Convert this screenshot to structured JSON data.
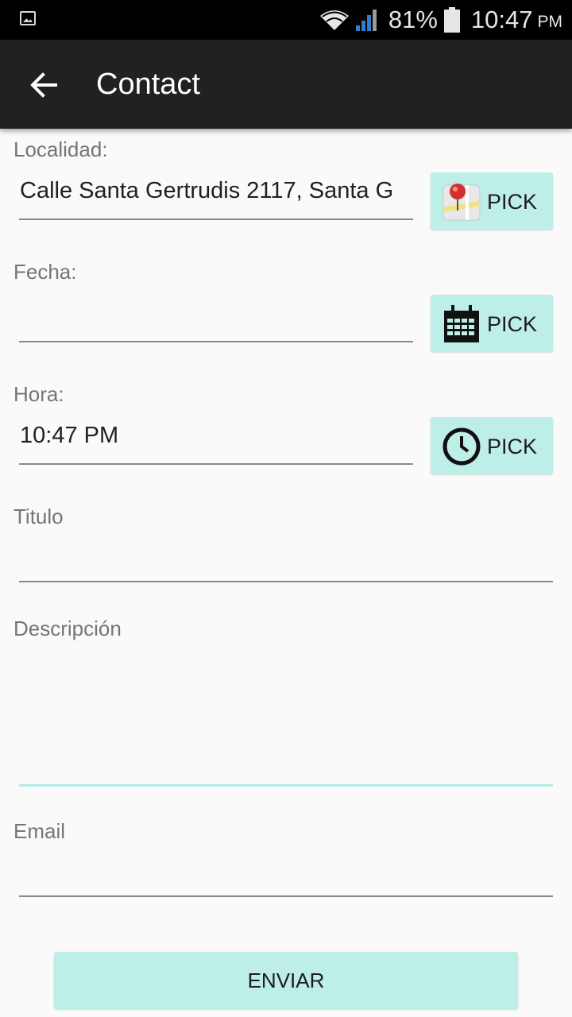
{
  "status_bar": {
    "battery_percent": "81%",
    "time": "10:47",
    "ampm": "PM",
    "icons": [
      "image-notification-icon",
      "wifi-icon",
      "cell-signal-icon",
      "battery-icon"
    ]
  },
  "app_bar": {
    "title": "Contact",
    "back_icon": "arrow-back-icon"
  },
  "form": {
    "localidad": {
      "label": "Localidad:",
      "value": "Calle Santa Gertrudis 2117, Santa G",
      "button": "PICK",
      "icon": "map-pin-icon"
    },
    "fecha": {
      "label": "Fecha:",
      "value": "",
      "button": "PICK",
      "icon": "calendar-icon"
    },
    "hora": {
      "label": "Hora:",
      "value": "10:47 PM",
      "button": "PICK",
      "icon": "clock-icon"
    },
    "titulo": {
      "label": "Titulo",
      "value": ""
    },
    "descripcion": {
      "label": "Descripción",
      "value": ""
    },
    "email": {
      "label": "Email",
      "value": ""
    },
    "submit_label": "ENVIAR"
  },
  "colors": {
    "accent": "#bdeee8",
    "app_bar": "#212121",
    "status_bar": "#000000",
    "background": "#fafafa"
  }
}
